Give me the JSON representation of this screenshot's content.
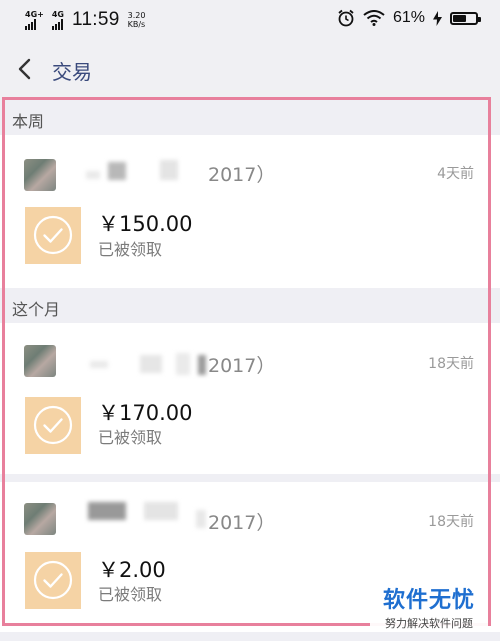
{
  "status_bar": {
    "network_1": "4G+",
    "network_2": "4G",
    "time": "11:59",
    "speed_value": "3.20",
    "speed_unit": "KB/s",
    "battery_percent": "61%",
    "battery_level": 0.61
  },
  "header": {
    "title": "交易"
  },
  "sections": [
    {
      "label": "本周"
    },
    {
      "label": "这个月"
    }
  ],
  "transactions": [
    {
      "name_suffix": "2017）",
      "time": "4天前",
      "amount": "￥150.00",
      "status": "已被领取"
    },
    {
      "name_suffix": "2017）",
      "time": "18天前",
      "amount": "￥170.00",
      "status": "已被领取"
    },
    {
      "name_suffix": "2017）",
      "time": "18天前",
      "amount": "￥2.00",
      "status": "已被领取"
    }
  ],
  "watermark": {
    "brand": "软件无忧",
    "tagline": "努力解决软件问题"
  },
  "colors": {
    "check_tile": "#f5d3a5",
    "title_blue": "#3a4a7c",
    "highlight_outline": "#e8809c",
    "watermark_blue": "#1f6fd0"
  }
}
